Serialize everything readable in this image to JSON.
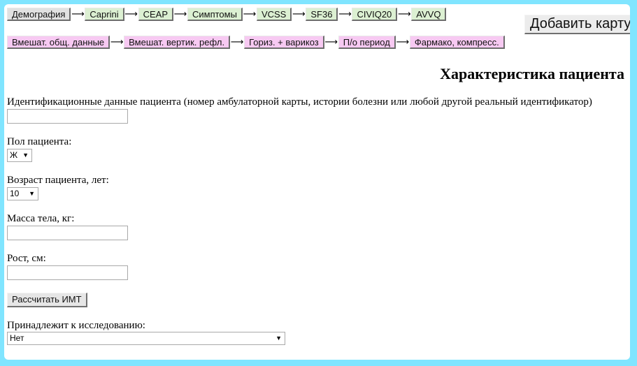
{
  "nav_row1": [
    {
      "label": "Демография",
      "color": "#e1e1e1"
    },
    {
      "label": "Caprini",
      "color": "#dcf0d2"
    },
    {
      "label": "CEAP",
      "color": "#dcf0d2"
    },
    {
      "label": "Симптомы",
      "color": "#dcf0d2"
    },
    {
      "label": "VCSS",
      "color": "#dcf0d2"
    },
    {
      "label": "SF36",
      "color": "#dcf0d2"
    },
    {
      "label": "CIVIQ20",
      "color": "#dcf0d2"
    },
    {
      "label": "AVVQ",
      "color": "#dcf0d2"
    }
  ],
  "nav_row2": [
    {
      "label": "Вмешат. общ. данные",
      "color": "#f7c9f2"
    },
    {
      "label": "Вмешат. вертик. рефл.",
      "color": "#f7c9f2"
    },
    {
      "label": "Гориз. + варикоз",
      "color": "#f7c9f2"
    },
    {
      "label": "П/о период",
      "color": "#f7c9f2"
    },
    {
      "label": "Фармако, компресс.",
      "color": "#f7c9f2"
    }
  ],
  "arrow_glyph": "⟶",
  "add_card_label": "Добавить карту",
  "page_title": "Характеристика пациента",
  "form": {
    "patient_id_label": "Идентификационные данные пациента (номер амбулаторной карты, истории болезни или любой другой реальный идентификатор)",
    "patient_id_value": "",
    "sex_label": "Пол пациента:",
    "sex_value": "Ж",
    "age_label": "Возраст пациента, лет:",
    "age_value": "10",
    "mass_label": "Масса тела, кг:",
    "mass_value": "",
    "height_label": "Рост, см:",
    "height_value": "",
    "calc_bmi_label": "Рассчитать ИМТ",
    "study_label": "Принадлежит к исследованию:",
    "study_value": "Нет"
  },
  "caret_glyph": "▼"
}
